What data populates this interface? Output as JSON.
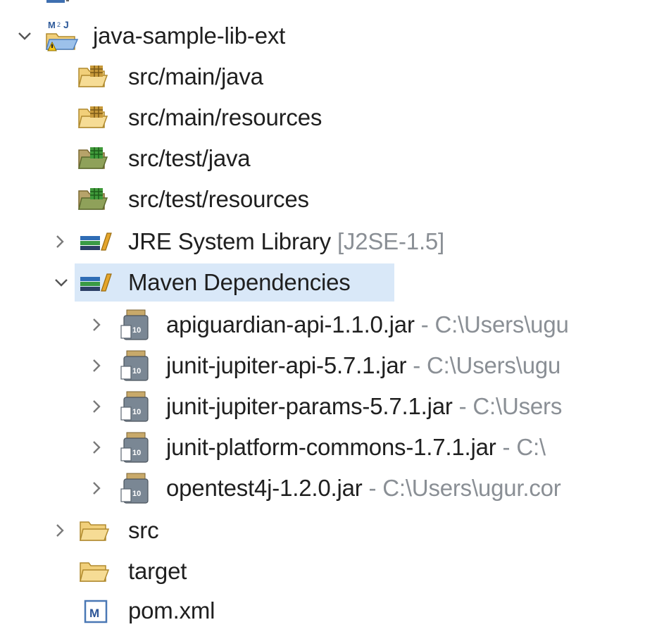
{
  "tree": {
    "project": {
      "label": "java-sample-lib-ext",
      "icon": "maven-project-icon",
      "expanded": true
    },
    "source_folders": [
      {
        "label": "src/main/java",
        "icon": "package-folder-icon"
      },
      {
        "label": "src/main/resources",
        "icon": "package-folder-icon"
      },
      {
        "label": "src/test/java",
        "icon": "test-package-folder-icon"
      },
      {
        "label": "src/test/resources",
        "icon": "test-package-folder-icon"
      }
    ],
    "jre": {
      "label": "JRE System Library",
      "decoration": "[J2SE-1.5]",
      "icon": "library-icon",
      "expanded": false
    },
    "maven_deps": {
      "label": "Maven Dependencies",
      "icon": "library-icon",
      "expanded": true,
      "selected": true
    },
    "jars": [
      {
        "label": "apiguardian-api-1.1.0.jar",
        "path": " - C:\\Users\\ugu"
      },
      {
        "label": "junit-jupiter-api-5.7.1.jar",
        "path": " - C:\\Users\\ugu"
      },
      {
        "label": "junit-jupiter-params-5.7.1.jar",
        "path": " - C:\\Users"
      },
      {
        "label": "junit-platform-commons-1.7.1.jar",
        "path": " - C:\\"
      },
      {
        "label": "opentest4j-1.2.0.jar",
        "path": " - C:\\Users\\ugur.cor"
      }
    ],
    "folders": [
      {
        "label": "src",
        "icon": "folder-icon",
        "expandable": true
      },
      {
        "label": "target",
        "icon": "folder-icon",
        "expandable": false
      }
    ],
    "pom": {
      "label": "pom.xml",
      "icon": "maven-pom-icon",
      "badge": "M"
    }
  },
  "colors": {
    "selection": "#d9e8f8",
    "decoration": "#8a8f95",
    "folder": "#f1cf7a",
    "chevron": "#555555"
  }
}
